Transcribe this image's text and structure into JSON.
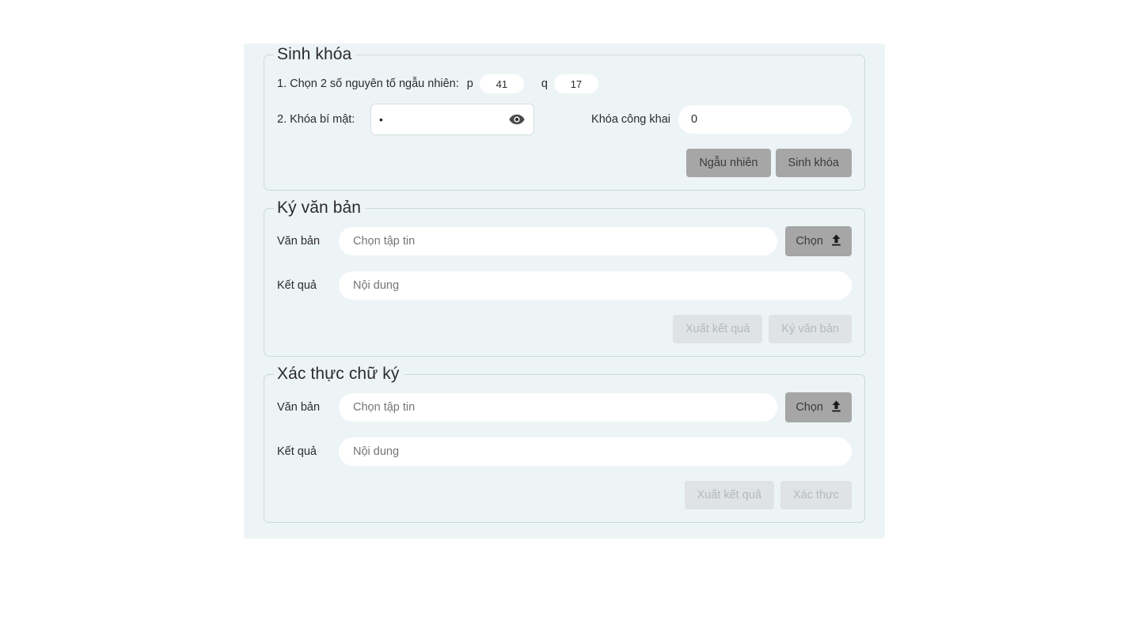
{
  "sections": {
    "keygen": {
      "legend": "Sinh khóa",
      "primes_label": "1. Chọn 2 số nguyên tố ngẫu nhiên:",
      "p_label": "p",
      "p_value": "41",
      "q_label": "q",
      "q_value": "17",
      "secret_label": "2. Khóa bí mật:",
      "secret_value": "•",
      "toggle_icon": "eye-icon",
      "public_label": "Khóa công khai",
      "public_value": "0",
      "random_button": "Ngẫu nhiên",
      "generate_button": "Sinh khóa"
    },
    "sign": {
      "legend": "Ký văn bản",
      "doc_label": "Văn bản",
      "doc_placeholder": "Chọn tập tin",
      "result_label": "Kết quả",
      "result_placeholder": "Nội dung",
      "choose_button": "Chọn",
      "choose_icon": "upload-icon",
      "export_button": "Xuất kết quả",
      "action_button": "Ký văn bản"
    },
    "verify": {
      "legend": "Xác thực chữ ký",
      "doc_label": "Văn bản",
      "doc_placeholder": "Chọn tập tin",
      "result_label": "Kết quả",
      "result_placeholder": "Nội dung",
      "choose_button": "Chọn",
      "choose_icon": "upload-icon",
      "export_button": "Xuất kết quả",
      "action_button": "Xác thực"
    }
  },
  "colors": {
    "panel_background": "#edf4f6",
    "border": "#cdd8dc",
    "button_active": "#a6a6a6",
    "button_disabled": "#dfe3e5",
    "button_disabled_text": "#b2b9bc",
    "text": "#2b2b2b",
    "field_background": "#ffffff"
  }
}
